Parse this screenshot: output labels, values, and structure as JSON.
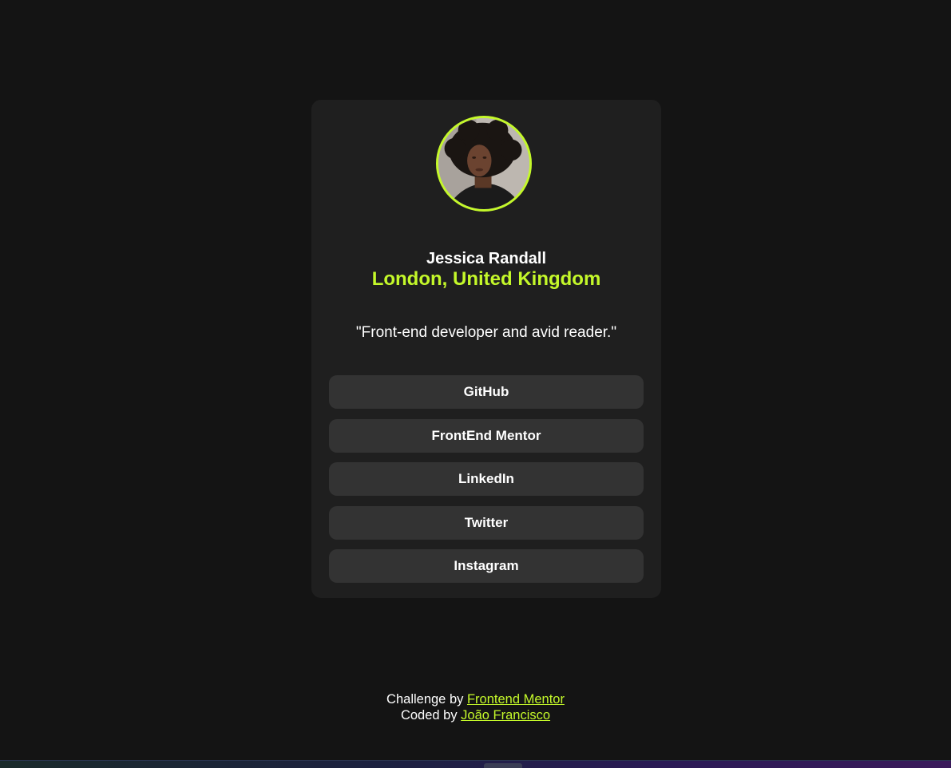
{
  "profile": {
    "name": "Jessica Randall",
    "location": "London, United Kingdom",
    "bio": "\"Front-end developer and avid reader.\"",
    "accent_color": "#c4f82a"
  },
  "links": [
    {
      "label": "GitHub"
    },
    {
      "label": "FrontEnd Mentor"
    },
    {
      "label": "LinkedIn"
    },
    {
      "label": "Twitter"
    },
    {
      "label": "Instagram"
    }
  ],
  "footer": {
    "challenge_prefix": "Challenge by",
    "challenge_link": "Frontend Mentor",
    "coded_prefix": "Coded by",
    "coded_link": "João Francisco"
  }
}
